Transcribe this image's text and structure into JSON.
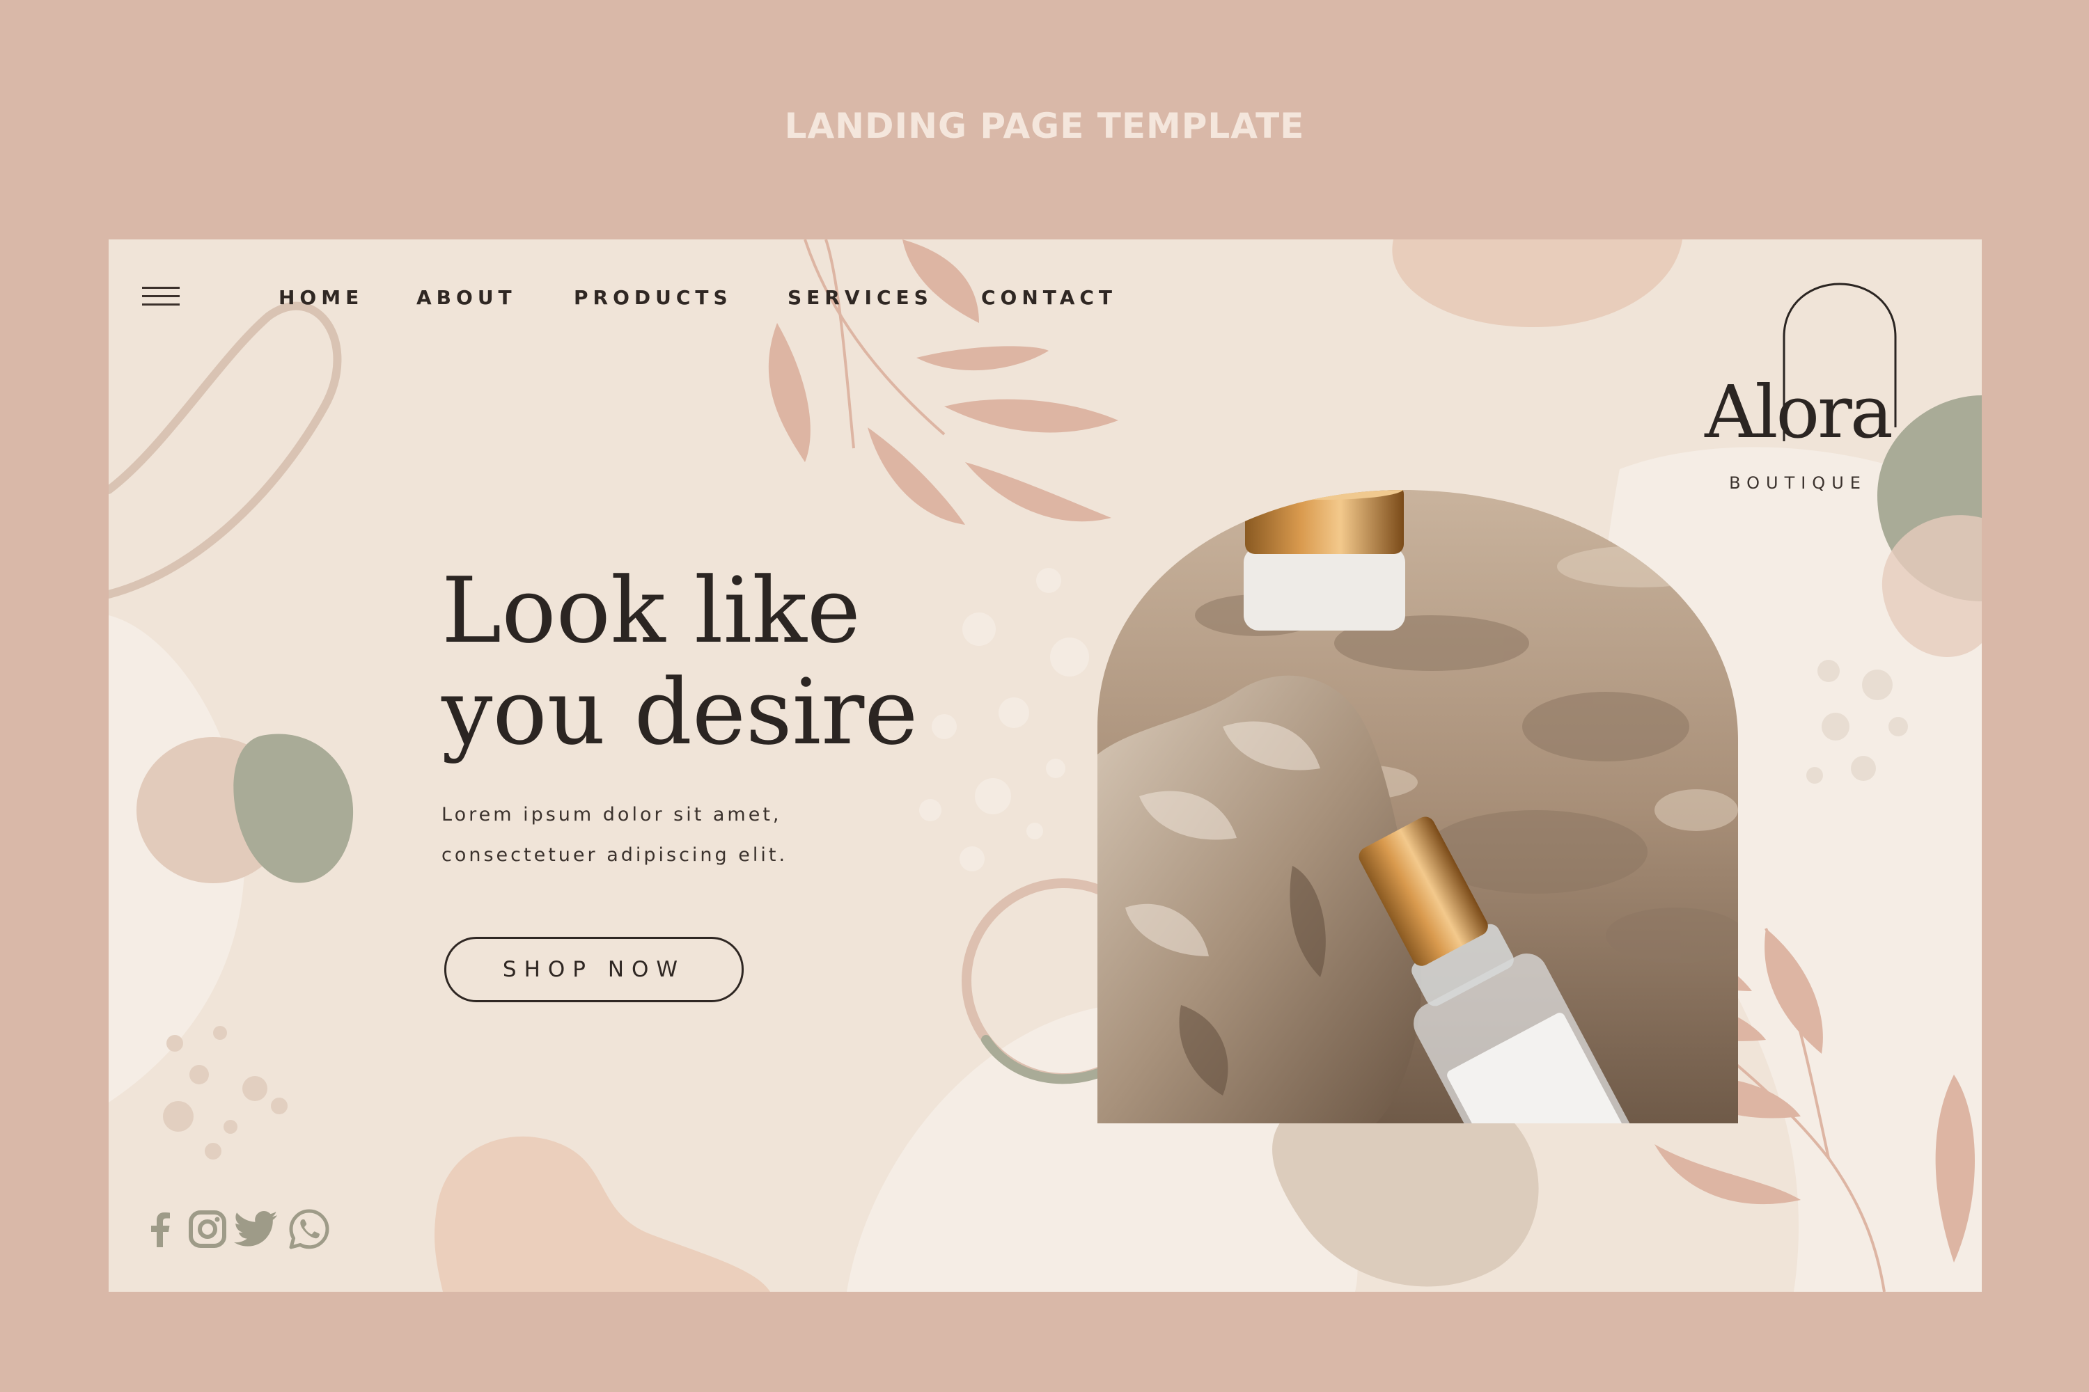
{
  "banner": {
    "title": "LANDING PAGE TEMPLATE"
  },
  "nav": {
    "items": [
      {
        "label": "HOME"
      },
      {
        "label": "ABOUT"
      },
      {
        "label": "PRODUCTS"
      },
      {
        "label": "SERVICES"
      },
      {
        "label": "CONTACT"
      }
    ]
  },
  "brand": {
    "name": "Alora",
    "subtitle": "BOUTIQUE"
  },
  "hero": {
    "title_line1": "Look like",
    "title_line2": "you desire",
    "desc_line1": "Lorem ipsum dolor sit amet,",
    "desc_line2": "consectetuer adipiscing elit.",
    "cta": "SHOP NOW"
  },
  "social": {
    "icons": [
      "facebook-icon",
      "instagram-icon",
      "twitter-icon",
      "whatsapp-icon"
    ]
  },
  "colors": {
    "outer_background": "#d9b8a8",
    "page_background": "#f0e4d8",
    "text_dark": "#2f2723",
    "sage_accent": "#a9ab97",
    "blush_accent": "#e2c3b1",
    "leaf_accent": "#ddb5a3"
  }
}
